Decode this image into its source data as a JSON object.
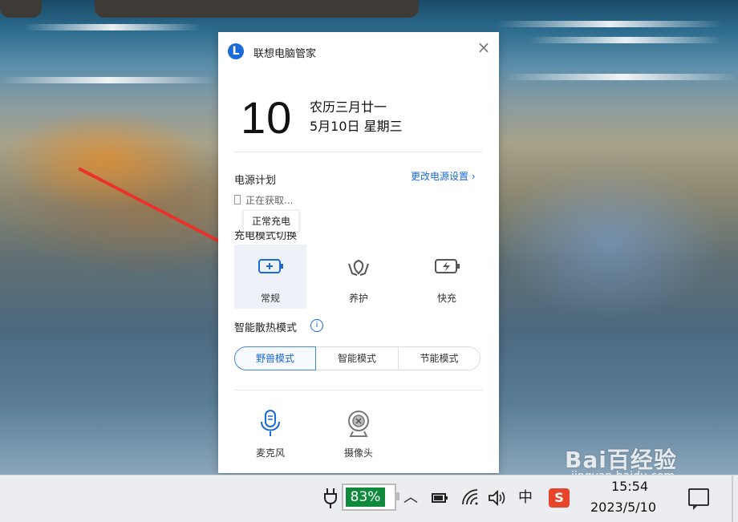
{
  "app": {
    "title": "联想电脑管家",
    "logo_letter": "L",
    "close_icon": "×"
  },
  "date_card": {
    "day": "10",
    "lunar": "农历三月廿一",
    "date": "5月10日 星期三"
  },
  "power_plan": {
    "label": "电源计划",
    "link": "更改电源设置 ›",
    "status": "正在获取..."
  },
  "tooltip": "正常充电",
  "charge_mode": {
    "label": "充电模式切换",
    "modes": [
      {
        "label": "常规",
        "icon": "battery-plus-icon",
        "active": true
      },
      {
        "label": "养护",
        "icon": "leaf-hands-icon",
        "active": false
      },
      {
        "label": "快充",
        "icon": "battery-bolt-icon",
        "active": false
      }
    ]
  },
  "cooling": {
    "label": "智能散热模式",
    "info": "i",
    "options": [
      {
        "label": "野兽模式",
        "active": true
      },
      {
        "label": "智能模式",
        "active": false
      },
      {
        "label": "节能模式",
        "active": false
      }
    ]
  },
  "devices": [
    {
      "label": "麦克风",
      "icon": "microphone-icon"
    },
    {
      "label": "摄像头",
      "icon": "camera-disabled-icon"
    }
  ],
  "taskbar": {
    "battery_percent": "83%",
    "battery_level": 0.83,
    "chevron": "︿",
    "ime": "中",
    "sogou": "S",
    "time": "15:54",
    "date": "2023/5/10"
  },
  "watermark": {
    "brand": "Bai百经验",
    "url": "jingyan.baidu.com"
  },
  "colors": {
    "accent": "#1a6ad8",
    "battery_green": "#0f8a3c",
    "arrow": "#e8322a"
  }
}
